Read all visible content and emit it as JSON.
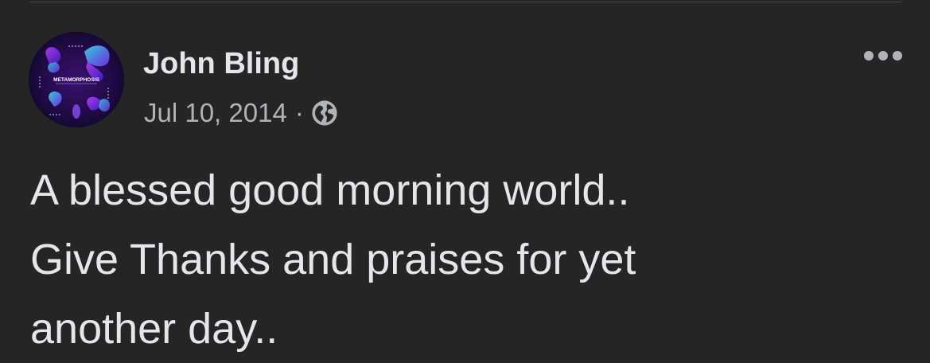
{
  "post": {
    "author": "John Bling",
    "date": "Jul 10, 2014",
    "separator": "·",
    "privacy_icon": "globe-icon",
    "more_icon": "more-options-icon",
    "text_lines": [
      "A blessed good morning world..",
      "Give Thanks and praises for yet",
      "another day.."
    ],
    "avatar_text": "METAMORPHOSIS"
  },
  "colors": {
    "background": "#252526",
    "primary_text": "#e4e6eb",
    "secondary_text": "#b0b3b8",
    "avatar_purple": "#6f2bd9",
    "avatar_cyan": "#2fd0e8"
  }
}
